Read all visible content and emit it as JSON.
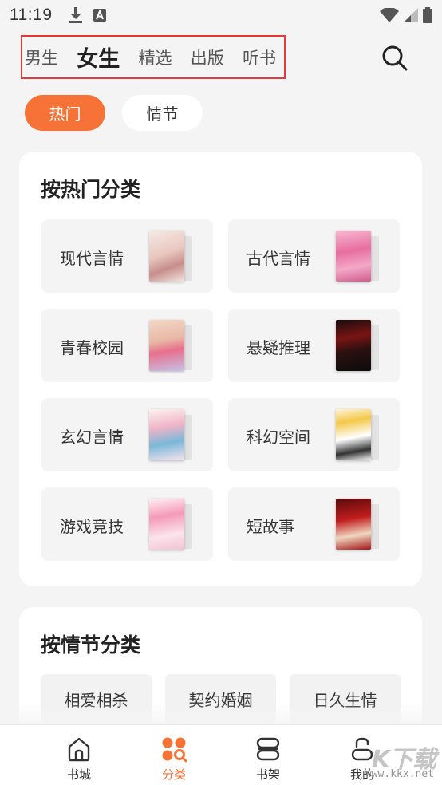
{
  "status_bar": {
    "time": "11:19"
  },
  "top_nav": {
    "tabs": [
      {
        "label": "男生",
        "active": false
      },
      {
        "label": "女生",
        "active": true
      },
      {
        "label": "精选",
        "active": false
      },
      {
        "label": "出版",
        "active": false
      },
      {
        "label": "听书",
        "active": false
      }
    ]
  },
  "chips": [
    {
      "label": "热门",
      "active": true
    },
    {
      "label": "情节",
      "active": false
    }
  ],
  "hot_section": {
    "title": "按热门分类",
    "items": [
      {
        "label": "现代言情"
      },
      {
        "label": "古代言情"
      },
      {
        "label": "青春校园"
      },
      {
        "label": "悬疑推理"
      },
      {
        "label": "玄幻言情"
      },
      {
        "label": "科幻空间"
      },
      {
        "label": "游戏竞技"
      },
      {
        "label": "短故事"
      }
    ]
  },
  "plot_section": {
    "title": "按情节分类",
    "items": [
      {
        "label": "相爱相杀"
      },
      {
        "label": "契约婚姻"
      },
      {
        "label": "日久生情"
      }
    ]
  },
  "bottom_nav": {
    "items": [
      {
        "label": "书城",
        "icon": "home-icon"
      },
      {
        "label": "分类",
        "icon": "category-icon",
        "active": true
      },
      {
        "label": "书架",
        "icon": "bookshelf-icon"
      },
      {
        "label": "我的",
        "icon": "profile-icon"
      }
    ]
  },
  "watermark": {
    "main": "K下载",
    "sub": "www.kkx.net"
  },
  "colors": {
    "accent": "#f77237",
    "highlight_box": "#e53935",
    "background": "#f4f4f4"
  }
}
